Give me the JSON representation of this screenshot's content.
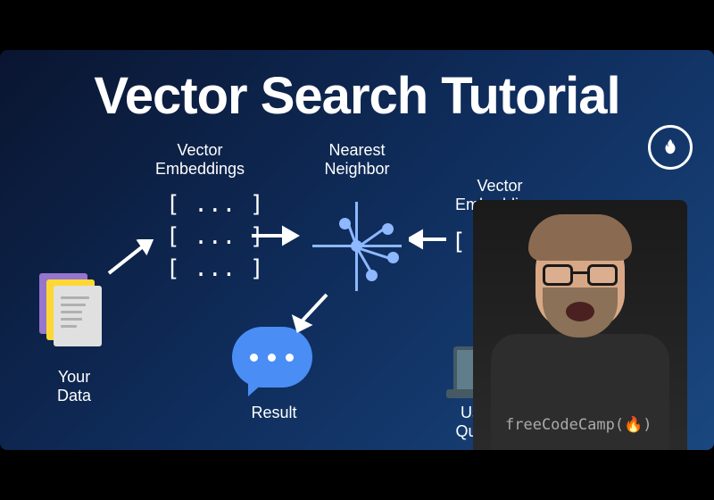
{
  "title": "Vector Search Tutorial",
  "brand": "freeCodeCamp",
  "shirt_text": "freeCodeCamp(🔥)",
  "labels": {
    "vector_embeddings_left": "Vector\nEmbeddings",
    "nearest_neighbor": "Nearest\nNeighbor",
    "vector_embeddings_right": "Vector\nEmbeddings",
    "your_data": "Your\nData",
    "result": "Result",
    "user_query": "User\nQuery"
  },
  "embeddings_left": [
    "[ ... ]",
    "[ ... ]",
    "[ ... ]"
  ],
  "embeddings_right": "[ ... ]",
  "diagram_flow": [
    {
      "from": "your_data",
      "to": "vector_embeddings_left"
    },
    {
      "from": "vector_embeddings_left",
      "to": "nearest_neighbor"
    },
    {
      "from": "user_query",
      "to": "vector_embeddings_right"
    },
    {
      "from": "vector_embeddings_right",
      "to": "nearest_neighbor"
    },
    {
      "from": "nearest_neighbor",
      "to": "result"
    }
  ]
}
